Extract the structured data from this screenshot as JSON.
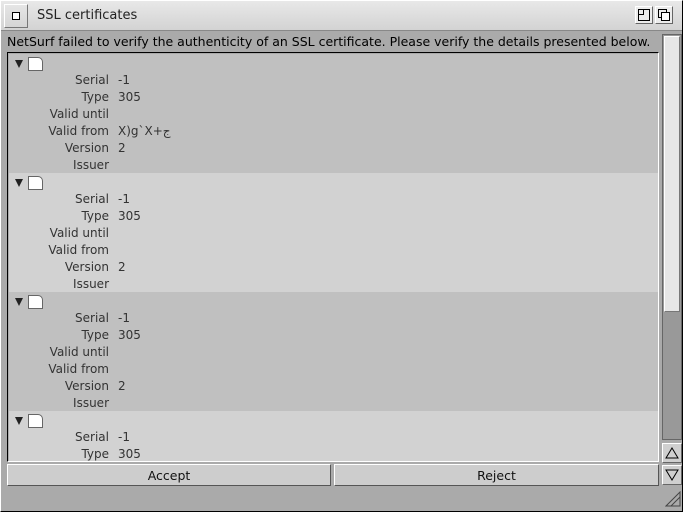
{
  "window": {
    "title": "SSL certificates"
  },
  "message": "NetSurf failed to verify the authenticity of an SSL certificate. Please verify the details presented below.",
  "labels": {
    "serial": "Serial",
    "type": "Type",
    "valid_until": "Valid until",
    "valid_from": "Valid from",
    "version": "Version",
    "issuer": "Issuer"
  },
  "certificates": [
    {
      "serial": "-1",
      "type": "305",
      "valid_until": "",
      "valid_from": "X)g`X+ج",
      "version": "2",
      "issuer": ""
    },
    {
      "serial": "-1",
      "type": "305",
      "valid_until": "",
      "valid_from": "",
      "version": "2",
      "issuer": ""
    },
    {
      "serial": "-1",
      "type": "305",
      "valid_until": "",
      "valid_from": "",
      "version": "2",
      "issuer": ""
    },
    {
      "serial": "-1",
      "type": "305",
      "valid_until": "",
      "valid_from": "",
      "version": "",
      "issuer": ""
    }
  ],
  "buttons": {
    "accept": "Accept",
    "reject": "Reject"
  },
  "icons": {
    "close": "close-icon",
    "zoom": "zoom-icon",
    "depth": "depth-icon",
    "expand": "triangle-down-icon",
    "certificate": "document-icon",
    "scroll_up": "arrow-up-icon",
    "scroll_down": "arrow-down-icon",
    "resize": "resize-icon"
  }
}
